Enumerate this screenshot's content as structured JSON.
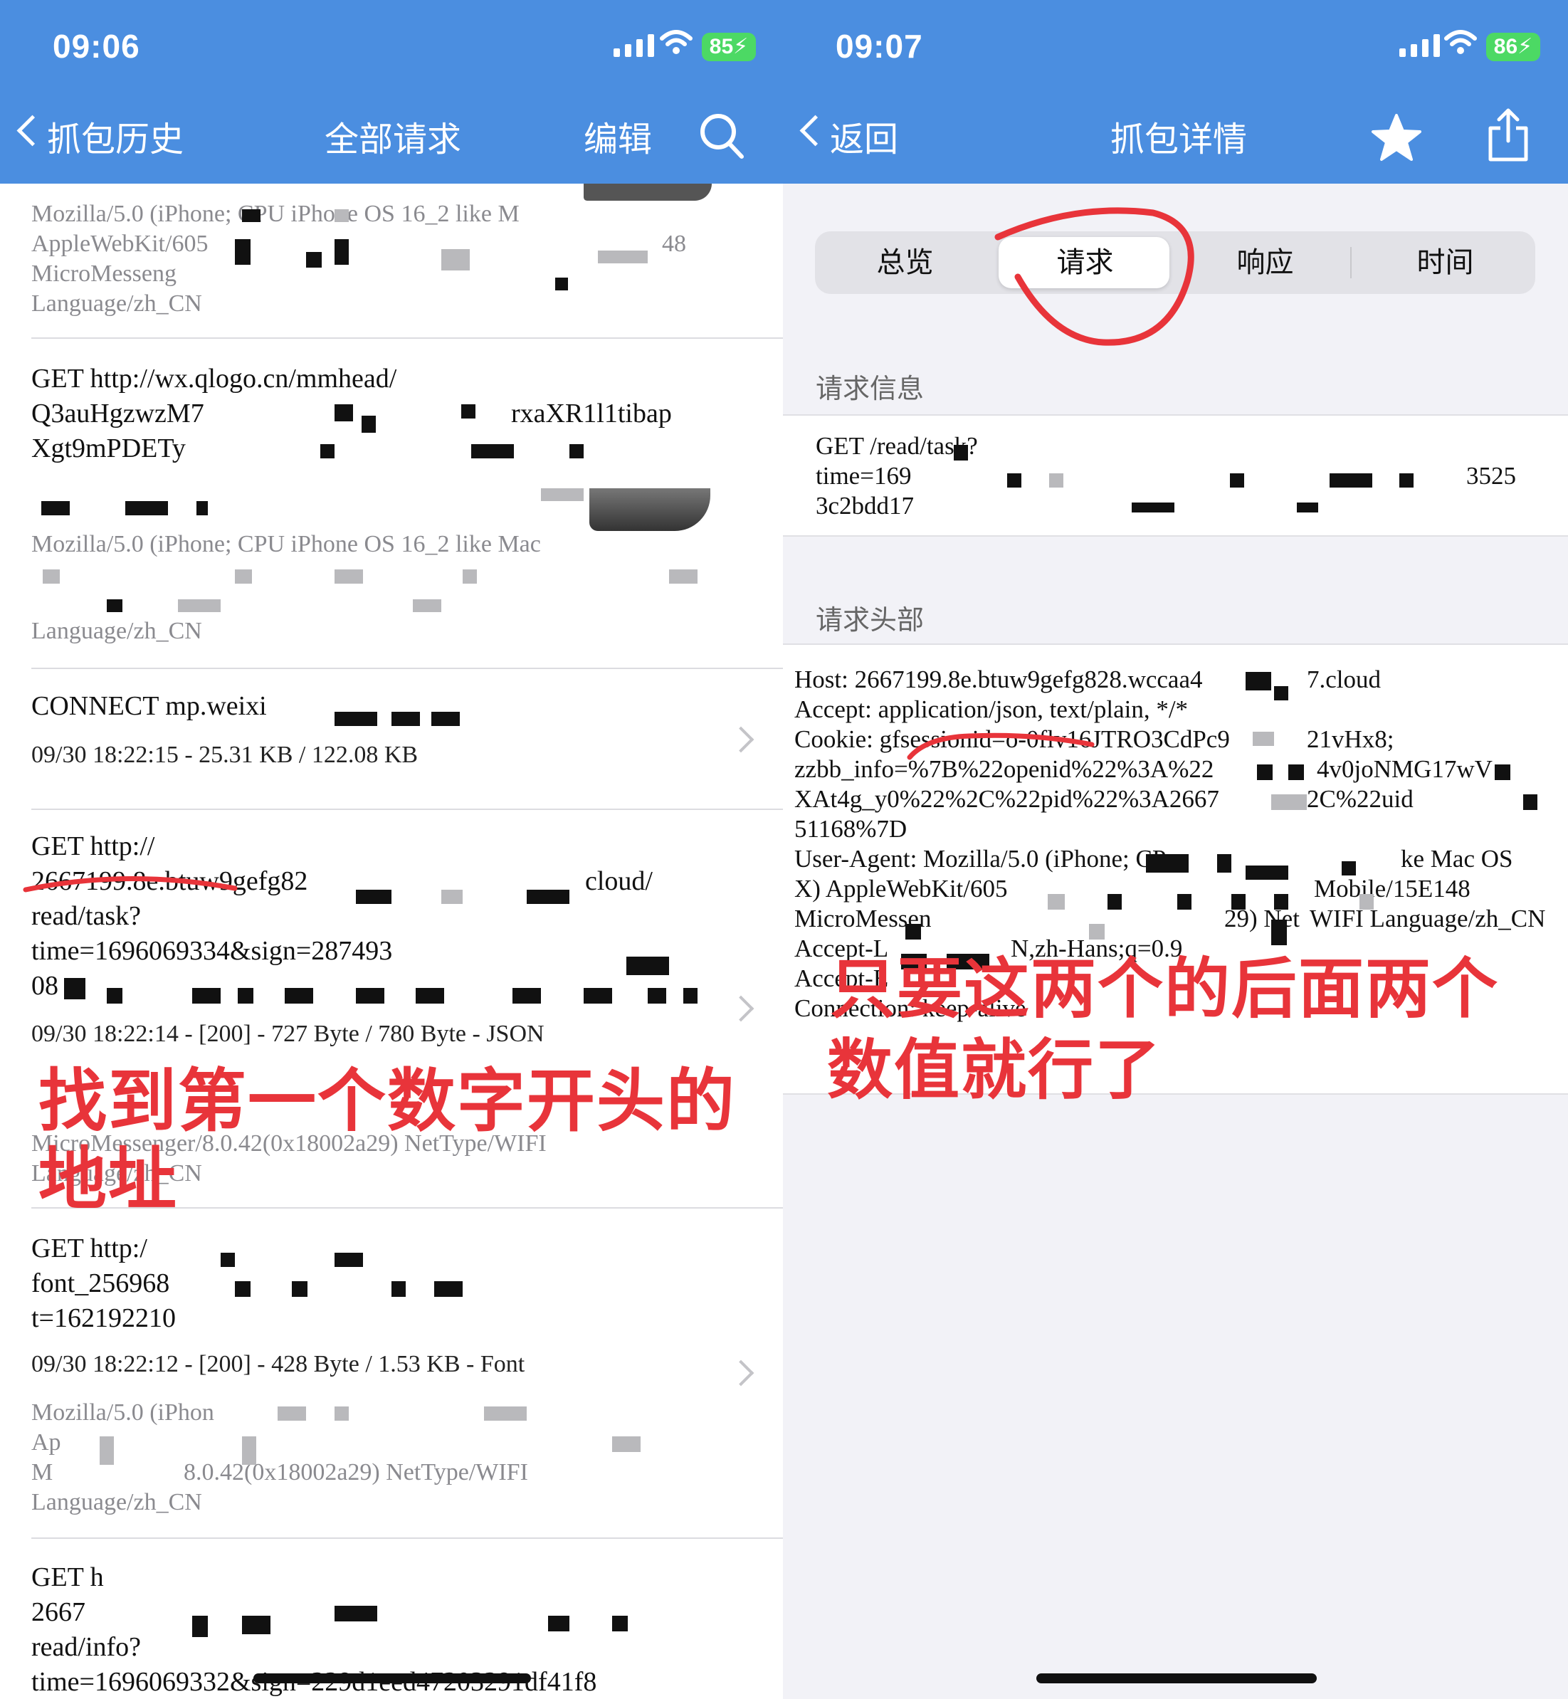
{
  "left": {
    "status": {
      "time": "09:06",
      "battery": "85"
    },
    "nav": {
      "back_label": "抓包历史",
      "title": "全部请求",
      "edit_label": "编辑"
    },
    "rows": [
      {
        "ua": [
          "Mozilla/5.0 (iPhone; CPU iPhone OS 16_2 like M",
          "AppleWebKit/605",
          "MicroMesseng",
          "Language/zh_CN"
        ],
        "ua_tail": "48"
      },
      {
        "lines": [
          "GET http://wx.qlogo.cn/mmhead/",
          "Q3auHgzwzM7",
          "Xgt9mPDETy"
        ],
        "line2_tail": "rxaXR1l1tibap",
        "ua": [
          "Mozilla/5.0 (iPhone; CPU iPhone OS 16_2 like Mac",
          "",
          "",
          "Language/zh_CN"
        ]
      },
      {
        "lines": [
          "CONNECT mp.weixi"
        ],
        "meta": "09/30 18:22:15 - 25.31 KB / 122.08 KB"
      },
      {
        "lines": [
          "GET http://",
          "2667199.8e.btuw9gefg82",
          "read/task?",
          "time=1696069334&sign=287493 ",
          "08"
        ],
        "line2_tail": "cloud/",
        "meta": "09/30 18:22:14 - [200] - 727 Byte / 780 Byte - JSON",
        "ua": [
          "MicroMessenger/8.0.42(0x18002a29) NetType/WIFI",
          "Language/zh_CN"
        ]
      },
      {
        "lines": [
          "GET http:/",
          "font_256968",
          "t=162192210"
        ],
        "meta": "09/30 18:22:12 - [200] - 428 Byte / 1.53 KB - Font",
        "ua": [
          "Mozilla/5.0 (iPhon",
          "Ap",
          "M",
          "Language/zh_CN"
        ],
        "ua_tail": "8.0.42(0x18002a29) NetType/WIFI"
      },
      {
        "lines": [
          "GET h",
          "2667",
          "read/info?",
          "time=1696069332&sign=229d1eed47203291df41f8"
        ]
      }
    ],
    "annotation": [
      "找到第一个数字开头的",
      "地址"
    ]
  },
  "right": {
    "status": {
      "time": "09:07",
      "battery": "86"
    },
    "nav": {
      "back_label": "返回",
      "title": "抓包详情"
    },
    "tabs": [
      "总览",
      "请求",
      "响应",
      "时间"
    ],
    "selected_tab": 1,
    "request_info": {
      "label": "请求信息",
      "lines": [
        "GET /read/task?",
        "time=169",
        "3c2bdd17"
      ],
      "line2_tail": "3525"
    },
    "headers": {
      "label": "请求头部",
      "lines": [
        "Host: 2667199.8e.btuw9gefg828.wccaa4",
        "Accept: application/json, text/plain, */*",
        "Cookie: gfsessionid=o-0flv16JTRO3CdPc9",
        "zzbb_info=%7B%22openid%22%3A%22",
        "XAt4g_y0%22%2C%22pid%22%3A2667",
        "51168%7D",
        "User-Agent: Mozilla/5.0 (iPhone; CP",
        "X) AppleWebKit/605",
        "MicroMessen",
        "Accept-L",
        "Accept-E",
        "Connection: keep-alive"
      ],
      "tails": [
        "7.cloud",
        "",
        "21vHx8;",
        "4v0joNMG17wV",
        "2C%22uid",
        "",
        "ke Mac OS",
        "Mobile/15E148",
        "WIFI Language/zh_CN",
        "N,zh-Hans;q=0.9",
        "",
        ""
      ],
      "mid": [
        "",
        "",
        "",
        "",
        "",
        "",
        "",
        "",
        "29) Net",
        "",
        "",
        ""
      ]
    },
    "annotation": [
      "只要这两个的后面两个",
      "数值就行了"
    ]
  },
  "colors": {
    "nav_bar": "#4b8ee0",
    "annotation_red": "#e8343a",
    "battery_green": "#4cd964"
  }
}
